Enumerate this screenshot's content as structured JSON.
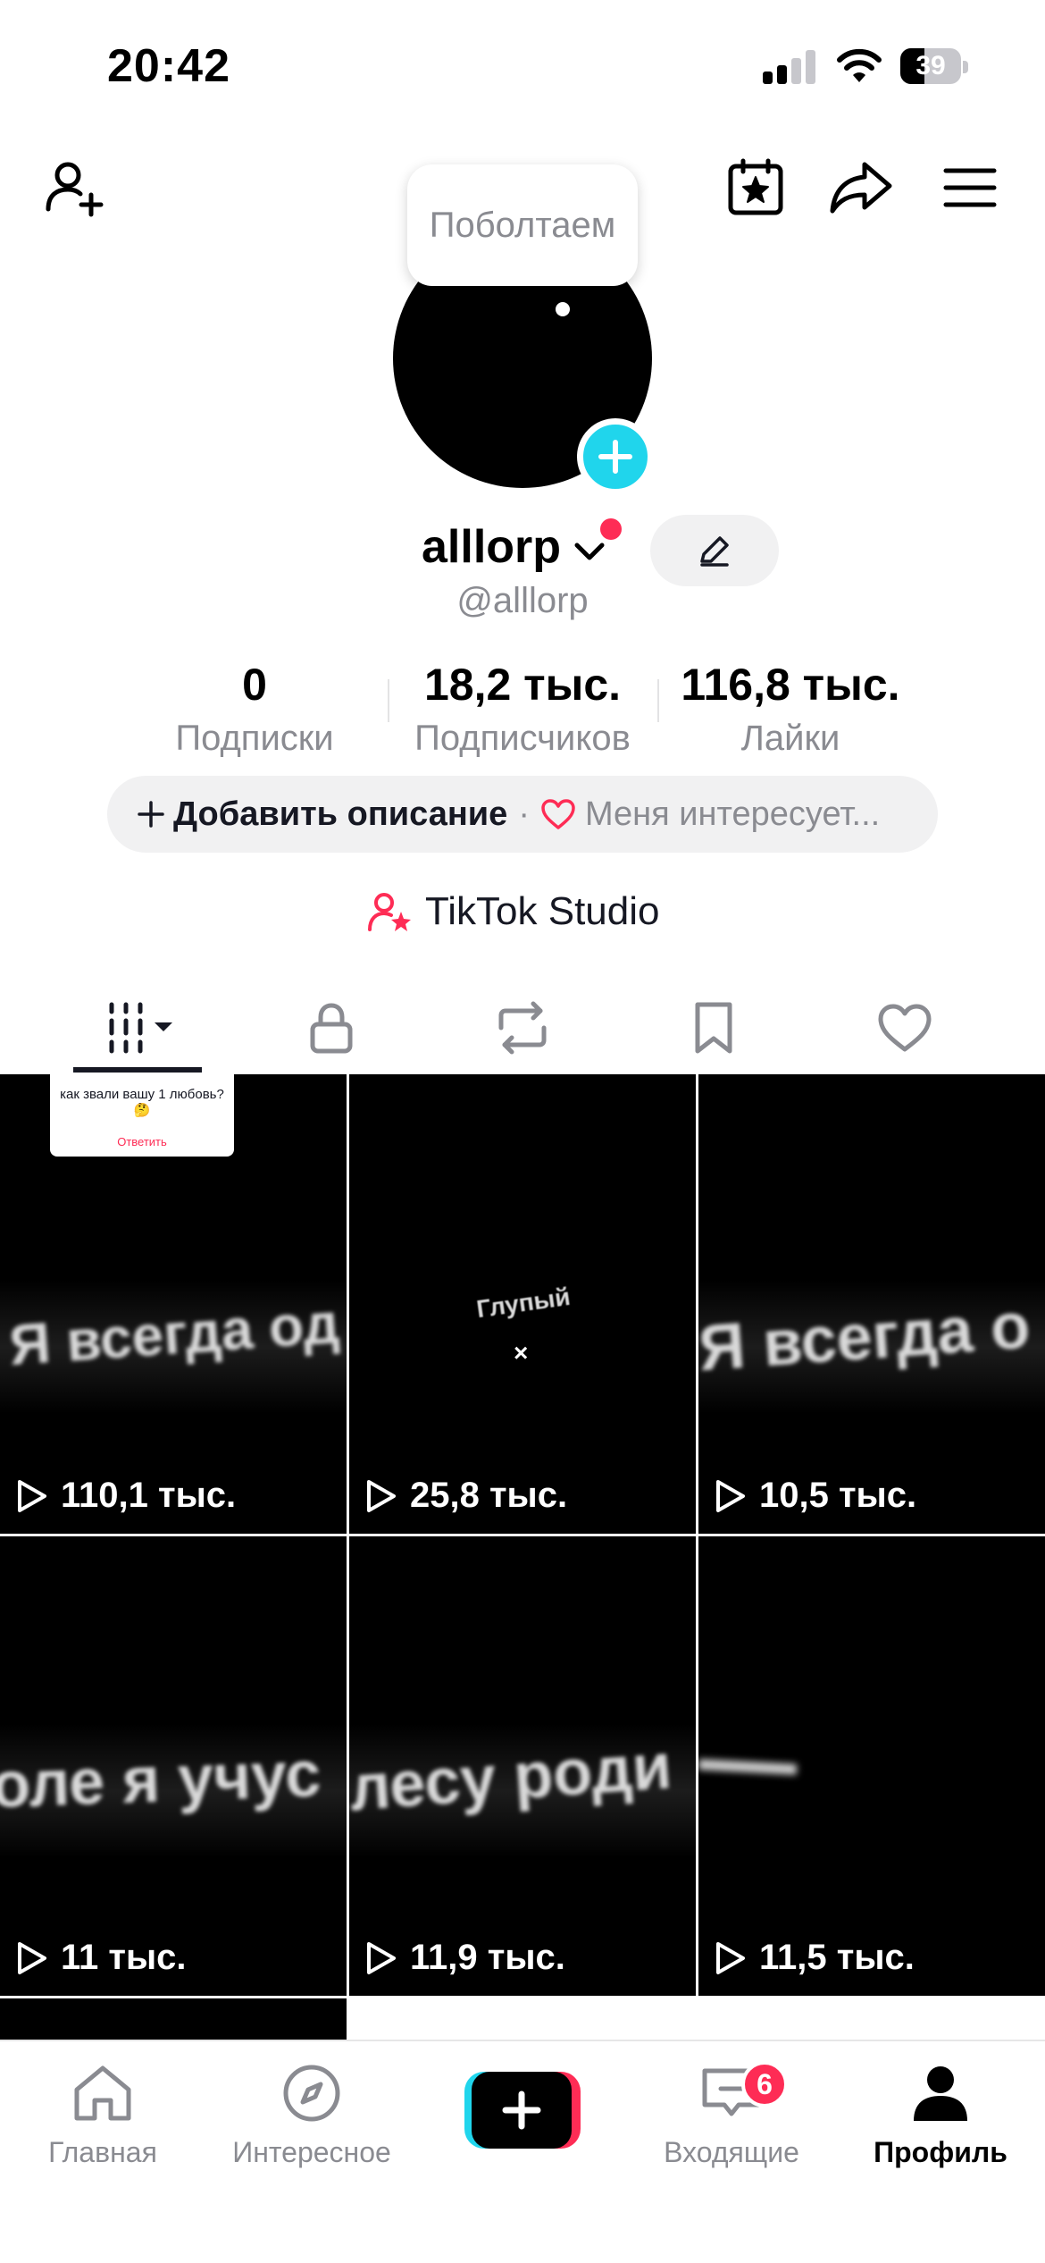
{
  "status_bar": {
    "time": "20:42",
    "battery": "39",
    "battery_level": 0.39
  },
  "bubble": {
    "text": "Поболтаем"
  },
  "profile": {
    "username": "alllorp",
    "handle": "@alllorp"
  },
  "stats": [
    {
      "value": "0",
      "label": "Подписки"
    },
    {
      "value": "18,2 тыс.",
      "label": "Подписчиков"
    },
    {
      "value": "116,8 тыс.",
      "label": "Лайки"
    }
  ],
  "bio": {
    "add_label": "Добавить описание",
    "separator": "·",
    "interest_label": "Меня интересует..."
  },
  "studio": {
    "label": "TikTok Studio"
  },
  "tabs": [
    {
      "icon": "videos-grid-icon",
      "active": true
    },
    {
      "icon": "lock-icon"
    },
    {
      "icon": "repost-icon"
    },
    {
      "icon": "bookmark-icon"
    },
    {
      "icon": "heart-icon"
    }
  ],
  "videos": [
    {
      "views": "110,1 тыс.",
      "overlay": "Я всегда од"
    },
    {
      "views": "25,8 тыс.",
      "overlay": "Глупый"
    },
    {
      "views": "10,5 тыс.",
      "overlay": "Я всегда о"
    },
    {
      "views": "11 тыс.",
      "overlay": "оле я учус"
    },
    {
      "views": "11,9 тыс.",
      "overlay": "лесу роди"
    },
    {
      "views": "11,5 тыс.",
      "overlay": ""
    }
  ],
  "reply_card": {
    "question": "как звали вашу 1 любовь? 🤔",
    "action": "Ответить"
  },
  "nav": [
    {
      "label": "Главная",
      "icon": "home-icon"
    },
    {
      "label": "Интересное",
      "icon": "compass-icon"
    },
    {
      "label": "",
      "icon": "create-icon"
    },
    {
      "label": "Входящие",
      "icon": "inbox-icon",
      "badge": "6"
    },
    {
      "label": "Профиль",
      "icon": "profile-icon",
      "active": true
    }
  ],
  "colors": {
    "accent": "#fe2c55",
    "cyan": "#20d5ec",
    "text": "#161823",
    "muted": "#8a8b91"
  }
}
